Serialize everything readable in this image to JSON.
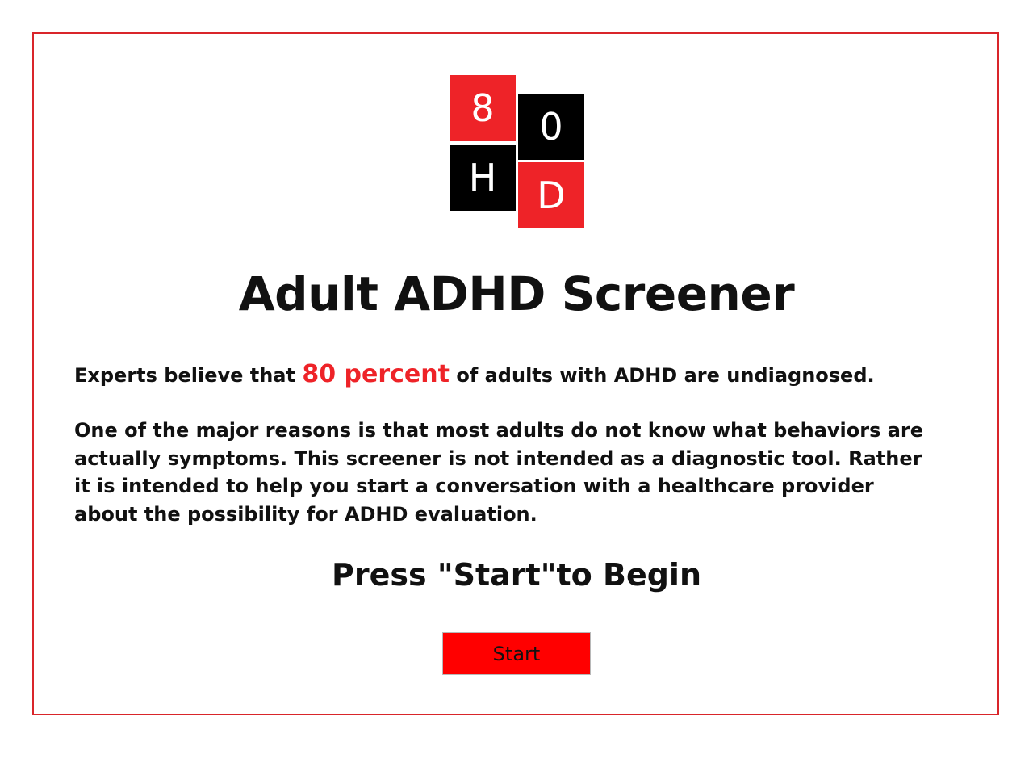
{
  "logo": {
    "tiles": [
      "8",
      "0",
      "H",
      "D"
    ],
    "colors": {
      "red": "#ee2328",
      "black": "#000000"
    }
  },
  "page": {
    "title": "Adult ADHD Screener",
    "intro_before": "Experts believe that ",
    "intro_highlight": "80 percent",
    "intro_after": " of adults with ADHD are undiagnosed.",
    "body": "One of the major reasons is that most adults do not know what behaviors are actually symptoms. This screener is not intended as a diagnostic tool. Rather it is intended to help you start a conversation with a healthcare provider about the possibility for ADHD evaluation.",
    "prompt": "Press \"Start\"to Begin",
    "start_label": "Start"
  },
  "colors": {
    "accent": "#ee2328",
    "frame_border": "#d9252a",
    "button_bg": "#ff0000"
  }
}
